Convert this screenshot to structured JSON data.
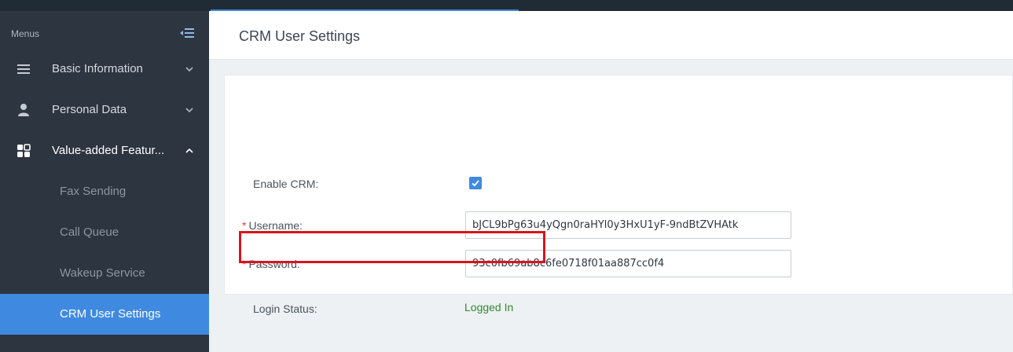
{
  "sidebar": {
    "menus_label": "Menus",
    "items": [
      {
        "label": "Basic Information",
        "icon": "list-icon",
        "expanded": false
      },
      {
        "label": "Personal Data",
        "icon": "user-icon",
        "expanded": false
      },
      {
        "label": "Value-added Featur...",
        "icon": "grid-icon",
        "expanded": true
      }
    ],
    "sub_items": [
      {
        "label": "Fax Sending",
        "active": false
      },
      {
        "label": "Call Queue",
        "active": false
      },
      {
        "label": "Wakeup Service",
        "active": false
      },
      {
        "label": "CRM User Settings",
        "active": true
      }
    ]
  },
  "page": {
    "title": "CRM User Settings"
  },
  "form": {
    "enable_crm_label": "Enable CRM:",
    "enable_crm_checked": true,
    "required_mark": "*",
    "username_label": "Username:",
    "username_value": "bJCL9bPg63u4yQgn0raHYl0y3HxU1yF-9ndBtZVHAtk",
    "password_label": "Password:",
    "password_value": "93c0fb69ab8c6fe0718f01aa887cc0f4",
    "login_status_label": "Login Status:",
    "login_status_value": "Logged In"
  },
  "colors": {
    "sidebar_bg": "#2d3540",
    "active_item": "#3f8ae0",
    "logged_in": "#2e8b2e",
    "highlight_border": "#d9141b",
    "required": "#e63b3b"
  }
}
